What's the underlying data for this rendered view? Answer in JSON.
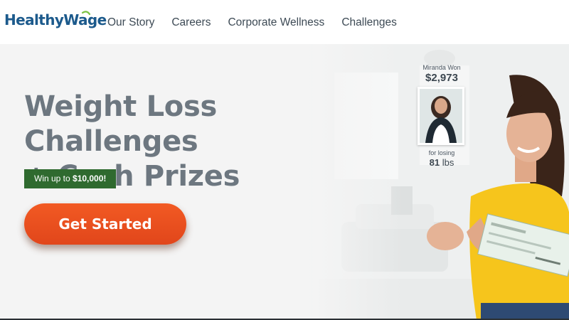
{
  "header": {
    "logo_text": "HealthyWage",
    "nav": [
      {
        "label": "Our Story"
      },
      {
        "label": "Careers"
      },
      {
        "label": "Corporate Wellness"
      },
      {
        "label": "Challenges"
      }
    ]
  },
  "hero": {
    "headline_line1": "Weight Loss Challenges",
    "headline_line2": "+ Cash Prizes",
    "badge_prefix": "Win up to ",
    "badge_amount": "$10,000!",
    "cta_label": "Get Started"
  },
  "winner": {
    "name": "Miranda Won",
    "amount": "$2,973",
    "for_text": "for losing",
    "lbs_value": "81",
    "lbs_unit": "lbs"
  },
  "colors": {
    "brand": "#1c5a8c",
    "cta": "#e94f1f",
    "badge": "#2f6a2f",
    "headline": "#6d7780",
    "shirt": "#f6c51c"
  },
  "icons": [
    "logo-swoosh-icon"
  ]
}
